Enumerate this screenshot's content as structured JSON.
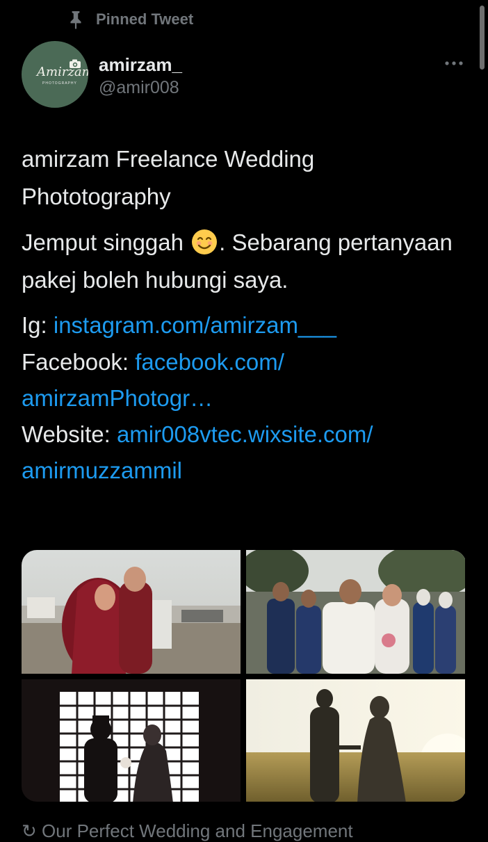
{
  "pinned": {
    "label": "Pinned Tweet",
    "icon": "pin-icon"
  },
  "author": {
    "display_name": "amirzam_",
    "handle": "@amir008",
    "avatar": {
      "script_text": "Amirzam",
      "sub_text": "PHOTOGRAPHY",
      "bg_color": "#4b6a56"
    }
  },
  "menu": {
    "icon": "more-icon"
  },
  "tweet": {
    "line1": "amirzam Freelance Wedding Phototography",
    "line2_before": "Jemput singgah",
    "line2_emoji": "smiling-face-icon",
    "line2_after": ". Sebarang pertanyaan pakej boleh hubungi saya.",
    "links": [
      {
        "label": "Ig: ",
        "url_text": "instagram.com/amirzam___"
      },
      {
        "label": "Facebook: ",
        "url_text": "facebook.com/ amirzamPhotogr…"
      },
      {
        "label": "Website: ",
        "url_text": "amir008vtec.wixsite.com/ amirmuzzammil"
      }
    ]
  },
  "media": [
    {
      "name": "photo-couple-red-outfit"
    },
    {
      "name": "photo-wedding-group"
    },
    {
      "name": "photo-window-silhouette"
    },
    {
      "name": "photo-field-sunset"
    }
  ],
  "next_item_text": "↻ Our Perfect Wedding and Engagement",
  "colors": {
    "link": "#1d9bf0",
    "muted": "#71767b",
    "text": "#e7e9ea",
    "background": "#000000"
  }
}
